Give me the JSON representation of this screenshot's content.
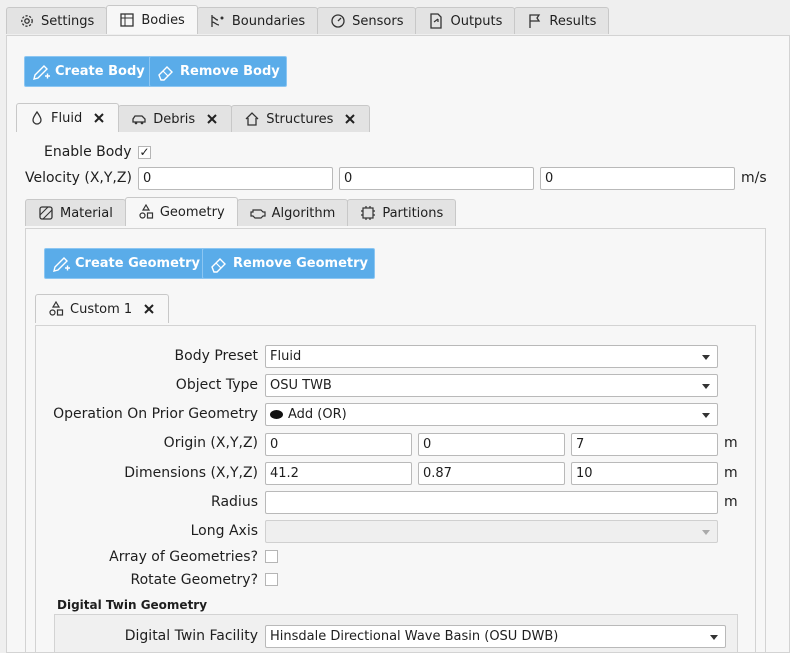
{
  "main_tabs": [
    {
      "label": "Settings",
      "icon": "gear-icon"
    },
    {
      "label": "Bodies",
      "icon": "cube-icon"
    },
    {
      "label": "Boundaries",
      "icon": "wave-icon"
    },
    {
      "label": "Sensors",
      "icon": "gauge-icon"
    },
    {
      "label": "Outputs",
      "icon": "export-icon"
    },
    {
      "label": "Results",
      "icon": "flag-icon"
    }
  ],
  "bodies": {
    "create_label": "Create Body",
    "remove_label": "Remove Body",
    "tabs": [
      {
        "label": "Fluid",
        "icon": "droplet-icon"
      },
      {
        "label": "Debris",
        "icon": "car-icon"
      },
      {
        "label": "Structures",
        "icon": "house-icon"
      }
    ],
    "enable_label": "Enable Body",
    "enable_checked": true,
    "velocity_label": "Velocity (X,Y,Z)",
    "velocity": [
      "0",
      "0",
      "0"
    ],
    "velocity_unit": "m/s"
  },
  "sub_tabs": [
    {
      "label": "Material",
      "icon": "material-icon"
    },
    {
      "label": "Geometry",
      "icon": "shapes-icon"
    },
    {
      "label": "Algorithm",
      "icon": "engine-icon"
    },
    {
      "label": "Partitions",
      "icon": "chip-icon"
    }
  ],
  "geometry": {
    "create_label": "Create Geometry",
    "remove_label": "Remove Geometry",
    "tab_label": "Custom 1",
    "body_preset_label": "Body Preset",
    "body_preset": "Fluid",
    "object_type_label": "Object Type",
    "object_type": "OSU TWB",
    "operation_label": "Operation On Prior Geometry",
    "operation": "Add (OR)",
    "origin_label": "Origin (X,Y,Z)",
    "origin": [
      "0",
      "0",
      "7"
    ],
    "dimensions_label": "Dimensions (X,Y,Z)",
    "dimensions": [
      "41.2",
      "0.87",
      "10"
    ],
    "radius_label": "Radius",
    "radius": "",
    "long_axis_label": "Long Axis",
    "long_axis": "",
    "array_label": "Array of Geometries?",
    "rotate_label": "Rotate Geometry?",
    "unit": "m",
    "digital_twin_header": "Digital Twin Geometry",
    "facility_label": "Digital Twin Facility",
    "facility": "Hinsdale Directional Wave Basin (OSU DWB)"
  },
  "colors": {
    "button": "#5aace9",
    "panel": "#f7f7f7"
  }
}
